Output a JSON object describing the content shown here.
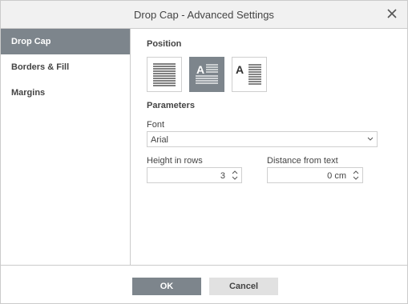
{
  "dialog": {
    "title": "Drop Cap - Advanced Settings"
  },
  "sidebar": {
    "items": [
      {
        "label": "Drop Cap",
        "active": true
      },
      {
        "label": "Borders & Fill",
        "active": false
      },
      {
        "label": "Margins",
        "active": false
      }
    ]
  },
  "position": {
    "heading": "Position",
    "options": [
      {
        "icon": "no-drop-cap-icon",
        "selected": false
      },
      {
        "icon": "drop-cap-in-text-icon",
        "selected": true,
        "glyph": "A"
      },
      {
        "icon": "drop-cap-in-margin-icon",
        "selected": false,
        "glyph": "A"
      }
    ]
  },
  "parameters": {
    "heading": "Parameters",
    "font_label": "Font",
    "font_value": "Arial",
    "height_label": "Height in rows",
    "height_value": "3",
    "distance_label": "Distance from text",
    "distance_value": "0 cm"
  },
  "footer": {
    "ok_label": "OK",
    "cancel_label": "Cancel"
  },
  "colors": {
    "accent": "#7d858c",
    "border": "#cbcbcb",
    "titlebar": "#f1f1f1"
  }
}
